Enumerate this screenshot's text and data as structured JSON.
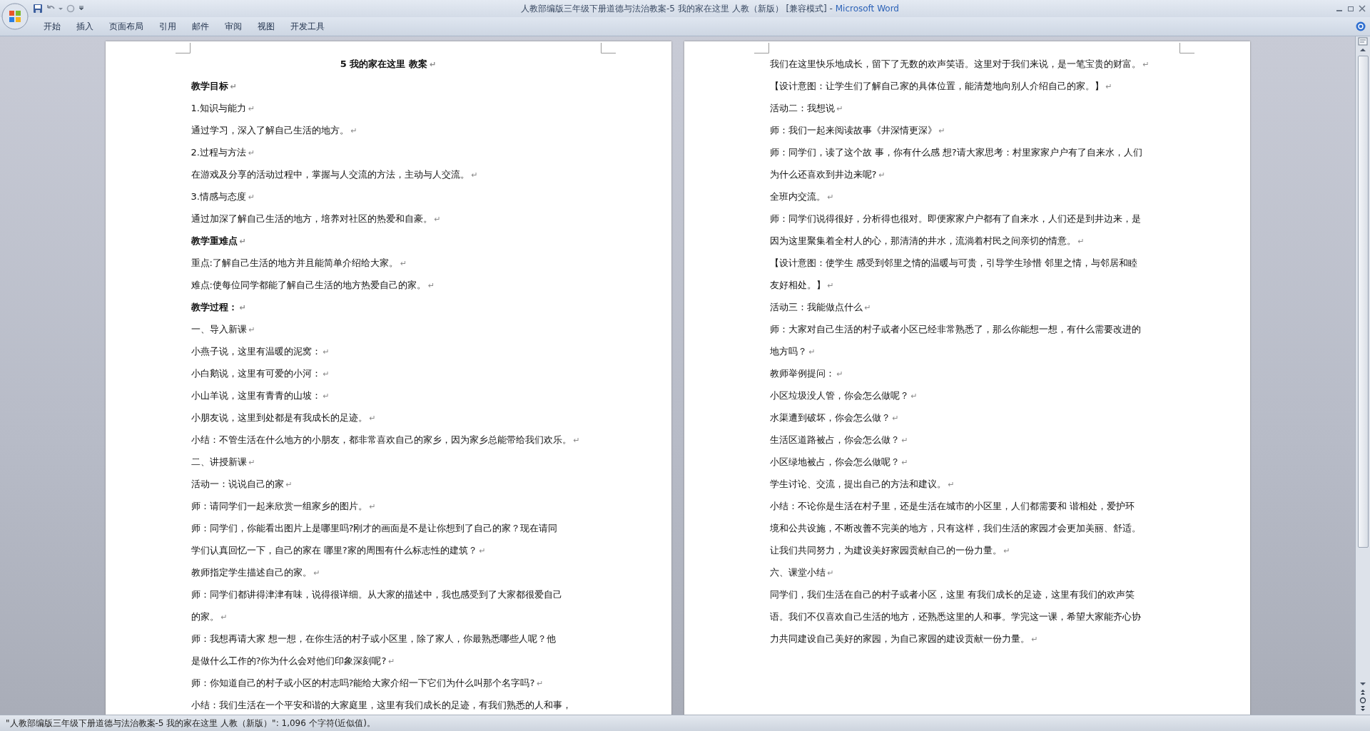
{
  "window": {
    "title": "人教部编版三年级下册道德与法治教案-5 我的家在这里 人教（新版） [兼容模式] - ",
    "app_name": "Microsoft Word"
  },
  "ribbon_tabs": [
    {
      "label": "开始"
    },
    {
      "label": "插入"
    },
    {
      "label": "页面布局"
    },
    {
      "label": "引用"
    },
    {
      "label": "邮件"
    },
    {
      "label": "审阅"
    },
    {
      "label": "视图"
    },
    {
      "label": "开发工具"
    }
  ],
  "pages": [
    {
      "paragraphs": [
        {
          "kind": "title",
          "lines": [
            "5  我的家在这里  教案"
          ],
          "mark": "↵"
        },
        {
          "kind": "heading",
          "lines": [
            "教学目标"
          ],
          "mark": "↵"
        },
        {
          "kind": "body",
          "lines": [
            "1.知识与能力"
          ],
          "mark": "↵"
        },
        {
          "kind": "body",
          "lines": [
            "通过学习，深入了解自己生活的地方。"
          ],
          "mark": "↵"
        },
        {
          "kind": "body",
          "lines": [
            "2.过程与方法"
          ],
          "mark": "↵"
        },
        {
          "kind": "body",
          "lines": [
            "在游戏及分享的活动过程中，掌握与人交流的方法，主动与人交流。"
          ],
          "mark": "↵"
        },
        {
          "kind": "body",
          "lines": [
            "3.情感与态度"
          ],
          "mark": "↵"
        },
        {
          "kind": "body",
          "lines": [
            "通过加深了解自己生活的地方，培养对社区的热爱和自豪。"
          ],
          "mark": "↵"
        },
        {
          "kind": "heading",
          "lines": [
            "教学重难点"
          ],
          "mark": "↵"
        },
        {
          "kind": "body",
          "lines": [
            "重点:了解自己生活的地方并且能简单介绍给大家。"
          ],
          "mark": "↵"
        },
        {
          "kind": "body",
          "lines": [
            "难点:使每位同学都能了解自己生活的地方热爱自己的家。"
          ],
          "mark": "↵"
        },
        {
          "kind": "heading",
          "lines": [
            "教学过程："
          ],
          "mark": "↵"
        },
        {
          "kind": "body",
          "lines": [
            "一、导入新课"
          ],
          "mark": "↵"
        },
        {
          "kind": "body",
          "lines": [
            "小燕子说，这里有温暖的泥窝："
          ],
          "mark": "↵"
        },
        {
          "kind": "body",
          "lines": [
            "小白鹅说，这里有可爱的小河："
          ],
          "mark": "↵"
        },
        {
          "kind": "body",
          "lines": [
            "小山羊说，这里有青青的山坡："
          ],
          "mark": "↵"
        },
        {
          "kind": "body",
          "lines": [
            "小朋友说，这里到处都是有我成长的足迹。"
          ],
          "mark": "↵"
        },
        {
          "kind": "body",
          "lines": [
            "小结：不管生活在什么地方的小朋友，都非常喜欢自己的家乡，因为家乡总能带给我们欢乐。"
          ],
          "mark": "↵"
        },
        {
          "kind": "body",
          "lines": [
            "二、讲授新课"
          ],
          "mark": "↵"
        },
        {
          "kind": "body",
          "lines": [
            "活动一：说说自己的家"
          ],
          "mark": "↵"
        },
        {
          "kind": "body",
          "lines": [
            "师：请同学们一起来欣赏一组家乡的图片。"
          ],
          "mark": "↵"
        },
        {
          "kind": "body",
          "lines": [
            "师：同学们，你能看出图片上是哪里吗?刚才的画面是不是让你想到了自己的家？现在请同",
            "学们认真回忆一下，自己的家在 哪里?家的周围有什么标志性的建筑？"
          ],
          "mark": "↵"
        },
        {
          "kind": "body",
          "lines": [
            "教师指定学生描述自己的家。"
          ],
          "mark": "↵"
        },
        {
          "kind": "body",
          "lines": [
            "师：同学们都讲得津津有味，说得很详细。从大家的描述中，我也感受到了大家都很爱自己",
            "的家。"
          ],
          "mark": "↵"
        },
        {
          "kind": "body",
          "lines": [
            "师：我想再请大家 想一想，在你生活的村子或小区里，除了家人，你最熟悉哪些人呢？他",
            "是做什么工作的?你为什么会对他们印象深刻呢?"
          ],
          "mark": "↵"
        },
        {
          "kind": "body",
          "lines": [
            "师：你知道自己的村子或小区的村志吗?能给大家介绍一下它们为什么叫那个名字吗?"
          ],
          "mark": "↵"
        },
        {
          "kind": "body",
          "lines": [
            "小结：我们生活在一个平安和谐的大家庭里，这里有我们成长的足迹，有我们熟悉的人和事，"
          ]
        }
      ]
    },
    {
      "paragraphs": [
        {
          "kind": "body",
          "lines": [
            "我们在这里快乐地成长，留下了无数的欢声笑语。这里对于我们来说，是一笔宝贵的财富。"
          ],
          "mark": "↵"
        },
        {
          "kind": "body",
          "lines": [
            "【设计意图：让学生们了解自己家的具体位置，能清楚地向别人介绍自己的家。】"
          ],
          "mark": "↵"
        },
        {
          "kind": "body",
          "lines": [
            "活动二：我想说"
          ],
          "mark": "↵"
        },
        {
          "kind": "body",
          "lines": [
            "师：我们一起来阅读故事《井深情更深》"
          ],
          "mark": "↵"
        },
        {
          "kind": "body",
          "lines": [
            "师：同学们，读了这个故 事，你有什么感 想?请大家思考：村里家家户户有了自来水，人们",
            "为什么还喜欢到井边来呢?"
          ],
          "mark": "↵"
        },
        {
          "kind": "body",
          "lines": [
            "全班内交流。"
          ],
          "mark": "↵"
        },
        {
          "kind": "body",
          "lines": [
            "师：同学们说得很好，分析得也很对。即便家家户户都有了自来水，人们还是到井边来，是",
            "因为这里聚集着全村人的心，那清清的井水，流淌着村民之间亲切的情意。"
          ],
          "mark": "↵"
        },
        {
          "kind": "body",
          "lines": [
            "【设计意图：使学生 感受到邻里之情的温暖与可贵，引导学生珍惜 邻里之情，与邻居和睦",
            "友好相处。】"
          ],
          "mark": "↵"
        },
        {
          "kind": "body",
          "lines": [
            "活动三：我能做点什么"
          ],
          "mark": "↵"
        },
        {
          "kind": "body",
          "lines": [
            "师：大家对自己生活的村子或者小区已经非常熟悉了，那么你能想一想，有什么需要改进的",
            "地方吗？"
          ],
          "mark": "↵"
        },
        {
          "kind": "body",
          "lines": [
            "教师举例提问："
          ],
          "mark": "↵"
        },
        {
          "kind": "body",
          "lines": [
            "小区垃圾没人管，你会怎么做呢？"
          ],
          "mark": "↵"
        },
        {
          "kind": "body",
          "lines": [
            "水渠遭到破坏，你会怎么做？"
          ],
          "mark": "↵"
        },
        {
          "kind": "body",
          "lines": [
            "生活区道路被占，你会怎么做？"
          ],
          "mark": "↵"
        },
        {
          "kind": "body",
          "lines": [
            "小区绿地被占，你会怎么做呢？"
          ],
          "mark": "↵"
        },
        {
          "kind": "body",
          "lines": [
            "学生讨论、交流，提出自己的方法和建议。"
          ],
          "mark": "↵"
        },
        {
          "kind": "body",
          "lines": [
            "小结：不论你是生活在村子里，还是生活在城市的小区里，人们都需要和 谐相处，爱护环",
            "境和公共设施，不断改善不完美的地方，只有这样，我们生活的家园才会更加美丽、舒适。",
            "让我们共同努力，为建设美好家园贡献自己的一份力量。"
          ],
          "mark": "↵"
        },
        {
          "kind": "body",
          "lines": [
            "六、课堂小结"
          ],
          "mark": "↵"
        },
        {
          "kind": "body",
          "lines": [
            "同学们，我们生活在自己的村子或者小区，这里 有我们成长的足迹，这里有我们的欢声笑",
            "语。我们不仅喜欢自己生活的地方，还熟悉这里的人和事。学完这一课，希望大家能齐心协",
            "力共同建设自己美好的家园，为自己家园的建设贡献一份力量。"
          ],
          "mark": "↵"
        }
      ]
    }
  ],
  "status_bar": {
    "text": "\"人教部编版三年级下册道德与法治教案-5 我的家在这里 人教（新版）\": 1,096 个字符(近似值)。"
  }
}
